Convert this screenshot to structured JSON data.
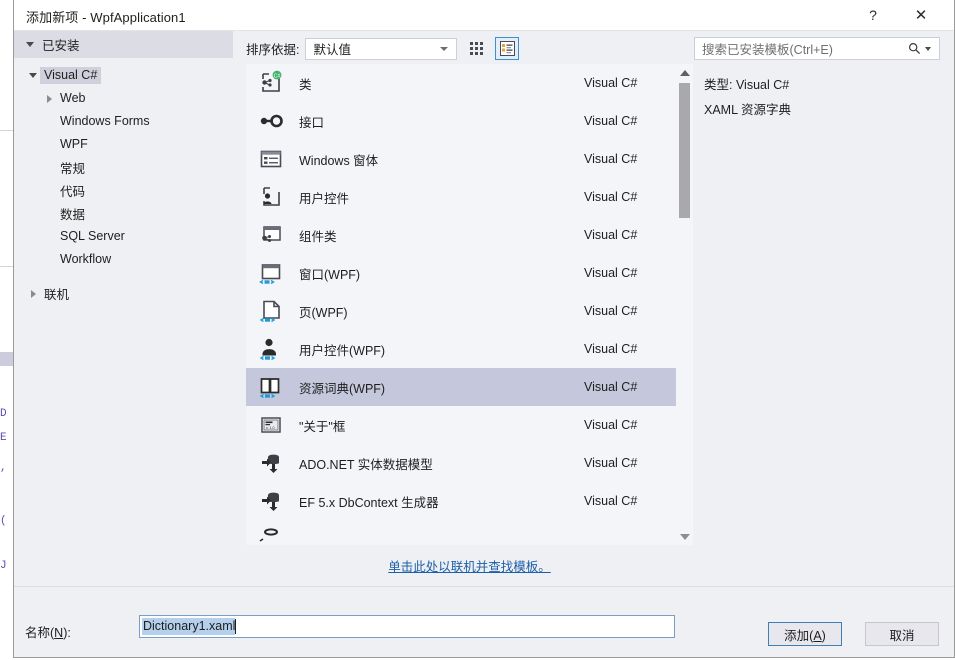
{
  "window": {
    "title": "添加新项 - WpfApplication1",
    "help_icon": "?",
    "close_icon": "✕"
  },
  "left_pane": {
    "installed_header": "已安装",
    "tree": [
      {
        "label": "Visual C#",
        "level": 0,
        "twisty": "down",
        "selected": true
      },
      {
        "label": "Web",
        "level": 1,
        "twisty": "right",
        "selected": false
      },
      {
        "label": "Windows Forms",
        "level": 1,
        "twisty": "none",
        "selected": false
      },
      {
        "label": "WPF",
        "level": 1,
        "twisty": "none",
        "selected": false
      },
      {
        "label": "常规",
        "level": 1,
        "twisty": "none",
        "selected": false
      },
      {
        "label": "代码",
        "level": 1,
        "twisty": "none",
        "selected": false
      },
      {
        "label": "数据",
        "level": 1,
        "twisty": "none",
        "selected": false
      },
      {
        "label": "SQL Server",
        "level": 1,
        "twisty": "none",
        "selected": false
      },
      {
        "label": "Workflow",
        "level": 1,
        "twisty": "none",
        "selected": false
      },
      {
        "label": "联机",
        "level": 0,
        "twisty": "right",
        "selected": false
      }
    ]
  },
  "toolbar": {
    "sort_label": "排序依据:",
    "sort_value": "默认值",
    "tile_view_icon": "grid-view-icon",
    "list_view_icon": "list-view-icon",
    "list_view_active": true
  },
  "search": {
    "placeholder": "搜索已安装模板(Ctrl+E)",
    "icon": "search-icon"
  },
  "templates": [
    {
      "name": "类",
      "lang": "Visual C#",
      "icon": "class-icon",
      "selected": false
    },
    {
      "name": "接口",
      "lang": "Visual C#",
      "icon": "interface-icon",
      "selected": false
    },
    {
      "name": "Windows 窗体",
      "lang": "Visual C#",
      "icon": "windows-form-icon",
      "selected": false
    },
    {
      "name": "用户控件",
      "lang": "Visual C#",
      "icon": "user-control-icon",
      "selected": false
    },
    {
      "name": "组件类",
      "lang": "Visual C#",
      "icon": "component-class-icon",
      "selected": false
    },
    {
      "name": "窗口(WPF)",
      "lang": "Visual C#",
      "icon": "wpf-window-icon",
      "selected": false
    },
    {
      "name": "页(WPF)",
      "lang": "Visual C#",
      "icon": "wpf-page-icon",
      "selected": false
    },
    {
      "name": "用户控件(WPF)",
      "lang": "Visual C#",
      "icon": "wpf-user-control-icon",
      "selected": false
    },
    {
      "name": "资源词典(WPF)",
      "lang": "Visual C#",
      "icon": "resource-dictionary-icon",
      "selected": true
    },
    {
      "name": "\"关于\"框",
      "lang": "Visual C#",
      "icon": "about-box-icon",
      "selected": false
    },
    {
      "name": "ADO.NET 实体数据模型",
      "lang": "Visual C#",
      "icon": "ado-net-model-icon",
      "selected": false
    },
    {
      "name": "EF 5.x DbContext 生成器",
      "lang": "Visual C#",
      "icon": "ef-dbcontext-icon",
      "selected": false
    }
  ],
  "details": {
    "type_line": "类型: Visual C#",
    "description": "XAML 资源字典"
  },
  "online_link": "单击此处以联机并查找模板。",
  "name_row": {
    "label": "名称(N):",
    "value": "Dictionary1.xaml"
  },
  "buttons": {
    "add": "添加(A)",
    "add_accel": "A",
    "cancel": "取消"
  },
  "colors": {
    "dialog_bg": "#eff0f3",
    "selection": "#c5c8dc",
    "link": "#1d5fa8",
    "default_button_border": "#3f7fb5",
    "text_selection": "#b5d0ec"
  }
}
